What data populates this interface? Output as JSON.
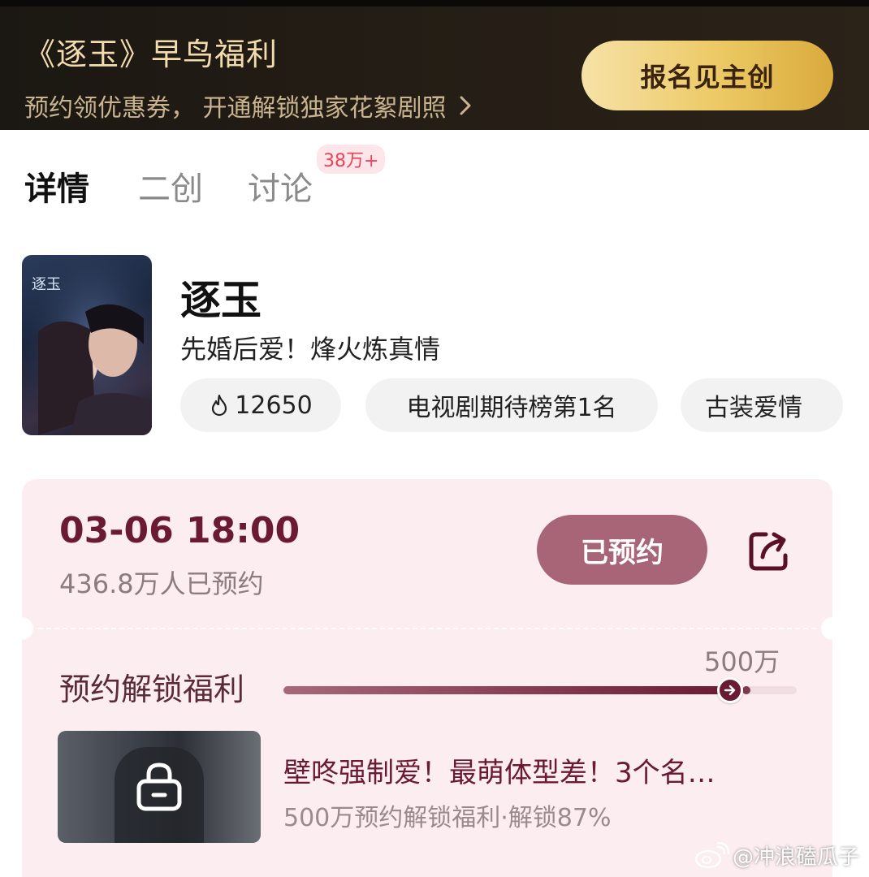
{
  "banner": {
    "title": "《逐玉》早鸟福利",
    "subtitle": "预约领优惠券， 开通解锁独家花絮剧照",
    "cta_label": "报名见主创"
  },
  "tabs": [
    {
      "label": "详情",
      "active": true
    },
    {
      "label": "二创",
      "active": false
    },
    {
      "label": "讨论",
      "active": false,
      "badge": "38万+"
    }
  ],
  "show": {
    "poster_text": "逐玉",
    "title": "逐玉",
    "slogan": "先婚后爱！烽火炼真情",
    "chips": [
      {
        "icon": "flame-icon",
        "label": "12650"
      },
      {
        "label": "电视剧期待榜第1名"
      },
      {
        "label": "古装爱情"
      }
    ]
  },
  "reservation": {
    "datetime": "03-06 18:00",
    "count_text": "436.8万人已预约",
    "button_label": "已预约",
    "share_icon": "share-icon"
  },
  "unlock": {
    "label": "预约解锁福利",
    "milestone_label": "500万",
    "progress_fraction": 0.87,
    "benefit_title": "壁咚强制爱！最萌体型差！3个名…",
    "benefit_sub": "500万预约解锁福利·解锁87%"
  },
  "watermark": "@冲浪磕瓜子",
  "colors": {
    "banner_bg": "#1b1712",
    "gold_button": "#ecc964",
    "accent_maroon": "#6b1a33",
    "reserved_button": "#a86577",
    "card_bg": "#fcedf1",
    "badge_red": "#e8445a"
  }
}
